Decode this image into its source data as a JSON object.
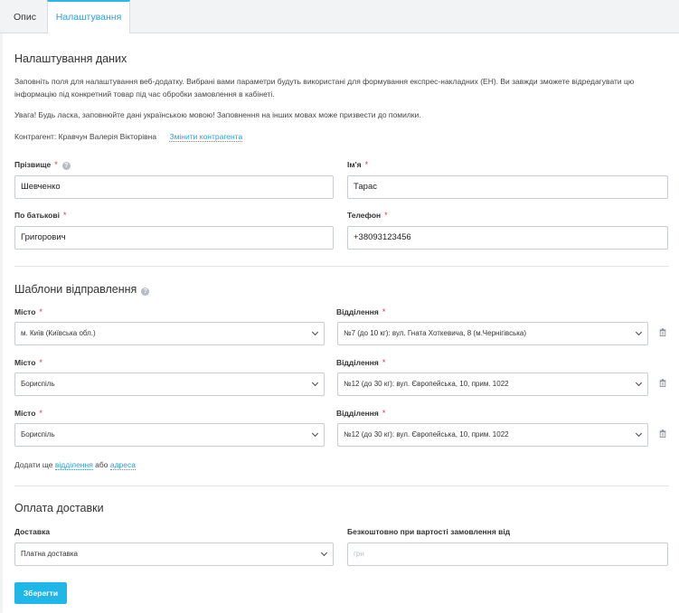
{
  "tabs": [
    {
      "label": "Опис"
    },
    {
      "label": "Налаштування"
    }
  ],
  "settings": {
    "title": "Налаштування даних",
    "description": "Заповніть поля для налаштування веб-додатку. Вибрані вами параметри будуть використані для формування експрес-накладних (ЕН). Ви завжди зможете відредагувати цю інформацію під конкретний товар під час обробки замовлення в кабінеті.",
    "warning": "Увага! Будь ласка, заповнюйте дані українською мовою! Заповнення на інших мовах може призвести до помилки.",
    "contractor_label": "Контрагент: Кравчун Валерія Вікторівна",
    "change_contractor": "Змінити контрагента",
    "fields": {
      "surname": {
        "label": "Прізвище",
        "value": "Шевченко"
      },
      "name": {
        "label": "Ім'я",
        "value": "Тарас"
      },
      "patronymic": {
        "label": "По батькові",
        "value": "Григорович"
      },
      "phone": {
        "label": "Телефон",
        "value": "+38093123456"
      }
    },
    "required_mark": "*",
    "info_mark": "?"
  },
  "templates": {
    "title": "Шаблони відправлення",
    "city_label": "Місто",
    "branch_label": "Відділення",
    "rows": [
      {
        "city": "м. Київ (Київська обл.)",
        "branch": "№7 (до 10 кг): вул. Гната Хоткевича, 8 (м.Чернігівська)"
      },
      {
        "city": "Бориспіль",
        "branch": "№12 (до 30 кг): вул. Європейська, 10, прим. 1022"
      },
      {
        "city": "Бориспіль",
        "branch": "№12 (до 30 кг): вул. Європейська, 10, прим. 1022"
      }
    ],
    "add_more_text": "Додати ще",
    "add_branch_link": "відділення",
    "or_text": "або",
    "add_address_link": "адреса"
  },
  "payment": {
    "title": "Оплата доставки",
    "delivery_label": "Доставка",
    "delivery_value": "Платна доставка",
    "free_label": "Безкоштовно при вартості замовлення від",
    "free_placeholder": "грн"
  },
  "save_label": "Зберегти"
}
